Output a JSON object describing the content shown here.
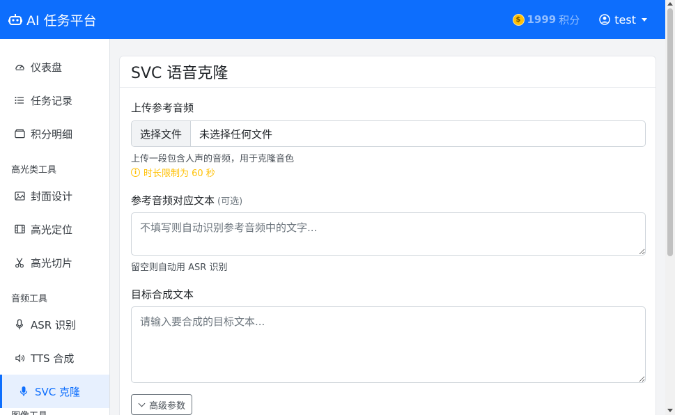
{
  "navbar": {
    "brand": "AI 任务平台",
    "points_value": "1999",
    "points_unit": "积分",
    "username": "test"
  },
  "sidebar": {
    "items_top": [
      {
        "label": "仪表盘",
        "icon": "gauge-icon"
      },
      {
        "label": "任务记录",
        "icon": "list-icon"
      },
      {
        "label": "积分明细",
        "icon": "wallet-icon"
      }
    ],
    "section_highlight": "高光类工具",
    "items_highlight": [
      {
        "label": "封面设计",
        "icon": "image-icon"
      },
      {
        "label": "高光定位",
        "icon": "film-icon"
      },
      {
        "label": "高光切片",
        "icon": "scissors-icon"
      }
    ],
    "section_audio": "音频工具",
    "items_audio": [
      {
        "label": "ASR 识别",
        "icon": "mic-icon"
      },
      {
        "label": "TTS 合成",
        "icon": "volume-icon"
      },
      {
        "label": "SVC 克隆",
        "icon": "mic-fill-icon",
        "active": true
      }
    ],
    "section_image": "图像工具"
  },
  "card": {
    "title": "SVC 语音克隆",
    "upload_label": "上传参考音频",
    "file_button": "选择文件",
    "file_status": "未选择任何文件",
    "upload_help": "上传一段包含人声的音频，用于克隆音色",
    "duration_warning": "时长限制为 60 秒",
    "ref_text_label": "参考音频对应文本",
    "ref_text_optional": "(可选)",
    "ref_text_placeholder": "不填写则自动识别参考音频中的文字...",
    "ref_text_help": "留空则自动用 ASR 识别",
    "target_label": "目标合成文本",
    "target_placeholder": "请输入要合成的目标文本...",
    "advanced_button": "高级参数"
  },
  "colors": {
    "primary": "#0d6efd",
    "warning": "#ffc107"
  }
}
